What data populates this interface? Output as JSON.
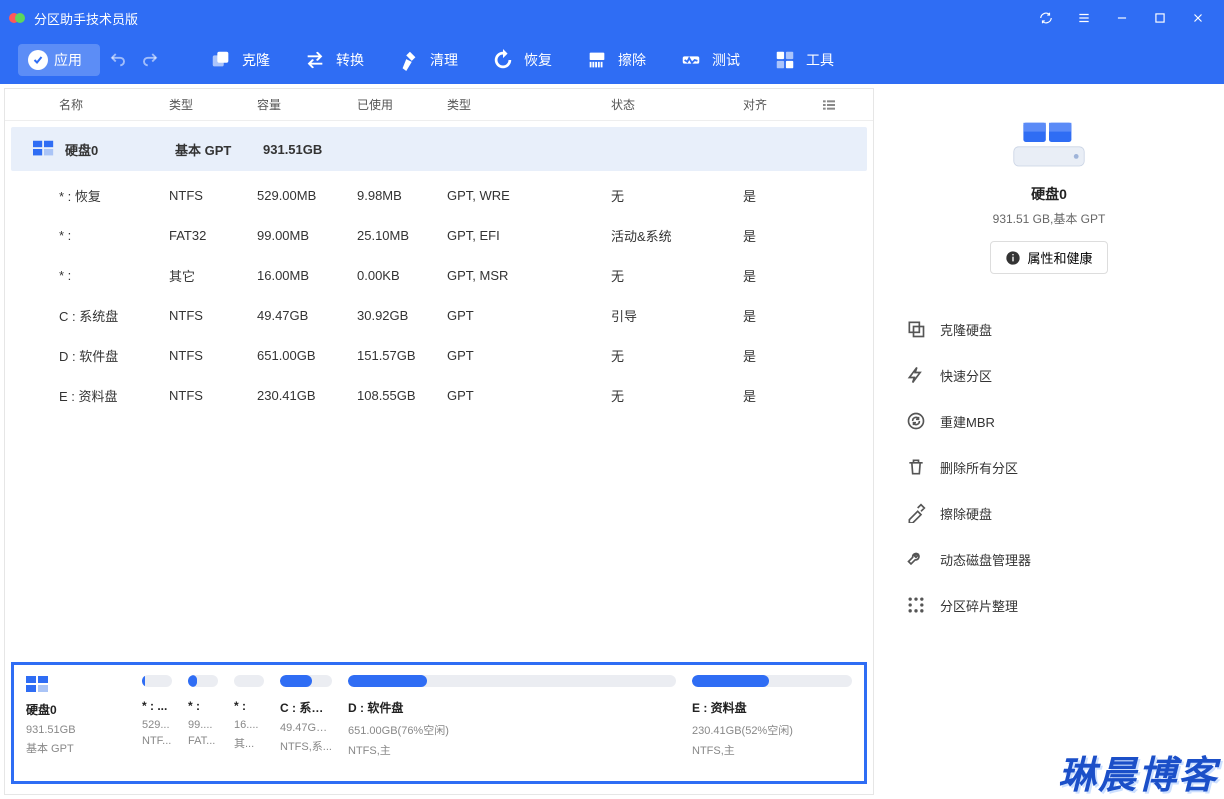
{
  "title": "分区助手技术员版",
  "toolbar": {
    "apply": "应用",
    "clone": "克隆",
    "convert": "转换",
    "cleanup": "清理",
    "recover": "恢复",
    "wipe": "擦除",
    "test": "测试",
    "tools": "工具"
  },
  "columns": {
    "name": "名称",
    "fs": "类型",
    "capacity": "容量",
    "used": "已使用",
    "ptype": "类型",
    "state": "状态",
    "align": "对齐"
  },
  "disk": {
    "name": "硬盘0",
    "type": "基本 GPT",
    "capacity": "931.51GB",
    "info_size": "931.51 GB,基本 GPT"
  },
  "partitions": [
    {
      "name": "* : 恢复",
      "fs": "NTFS",
      "cap": "529.00MB",
      "used": "9.98MB",
      "ptype": "GPT, WRE",
      "state": "无",
      "align": "是"
    },
    {
      "name": "* :",
      "fs": "FAT32",
      "cap": "99.00MB",
      "used": "25.10MB",
      "ptype": "GPT, EFI",
      "state": "活动&系统",
      "align": "是"
    },
    {
      "name": "* :",
      "fs": "其它",
      "cap": "16.00MB",
      "used": "0.00KB",
      "ptype": "GPT, MSR",
      "state": "无",
      "align": "是"
    },
    {
      "name": "C : 系统盘",
      "fs": "NTFS",
      "cap": "49.47GB",
      "used": "30.92GB",
      "ptype": "GPT",
      "state": "引导",
      "align": "是"
    },
    {
      "name": "D : 软件盘",
      "fs": "NTFS",
      "cap": "651.00GB",
      "used": "151.57GB",
      "ptype": "GPT",
      "state": "无",
      "align": "是"
    },
    {
      "name": "E : 资料盘",
      "fs": "NTFS",
      "cap": "230.41GB",
      "used": "108.55GB",
      "ptype": "GPT",
      "state": "无",
      "align": "是"
    }
  ],
  "strip": {
    "disk": {
      "label": "硬盘0",
      "size": "931.51GB",
      "type": "基本 GPT"
    },
    "items": [
      {
        "label": "* : ...",
        "size": "529...",
        "fs": "NTF...",
        "fill": 10
      },
      {
        "label": "* :",
        "size": "99....",
        "fs": "FAT...",
        "fill": 30
      },
      {
        "label": "* :",
        "size": "16....",
        "fs": "其...",
        "fill": 0
      },
      {
        "label": "C : 系统盘",
        "size": "49.47GB...",
        "fs": "NTFS,系...",
        "fill": 62
      },
      {
        "label": "D : 软件盘",
        "size": "651.00GB(76%空闲)",
        "fs": "NTFS,主",
        "fill": 24
      },
      {
        "label": "E : 资料盘",
        "size": "230.41GB(52%空闲)",
        "fs": "NTFS,主",
        "fill": 48
      }
    ]
  },
  "side": {
    "prop": "属性和健康",
    "actions": [
      "克隆硬盘",
      "快速分区",
      "重建MBR",
      "删除所有分区",
      "擦除硬盘",
      "动态磁盘管理器",
      "分区碎片整理"
    ]
  },
  "watermark": "琳晨博客"
}
